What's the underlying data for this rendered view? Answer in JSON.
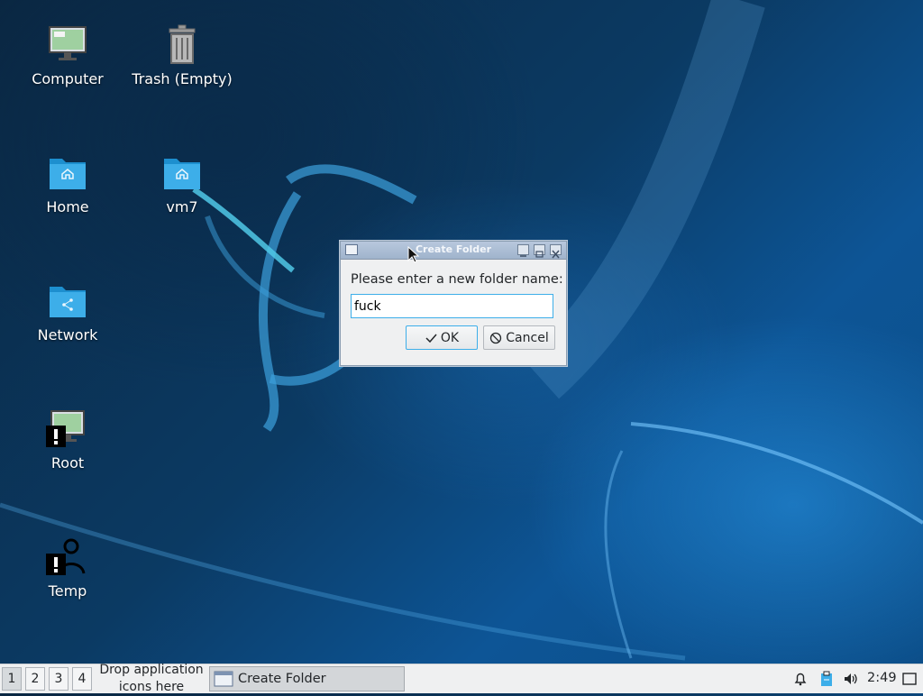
{
  "desktop": {
    "icons": [
      {
        "label": "Computer",
        "icon": "computer-icon"
      },
      {
        "label": "Trash (Empty)",
        "icon": "trash-icon"
      },
      {
        "label": "Home",
        "icon": "home-folder-icon"
      },
      {
        "label": "vm7",
        "icon": "home-folder-icon"
      },
      {
        "label": "Network",
        "icon": "network-folder-icon"
      },
      {
        "label": "Root",
        "icon": "computer-warning-icon"
      },
      {
        "label": "Temp",
        "icon": "user-warning-icon"
      }
    ]
  },
  "dialog": {
    "title": "Create Folder",
    "prompt": "Please enter a new folder name:",
    "input_value": "fuck",
    "ok_label": "OK",
    "cancel_label": "Cancel"
  },
  "taskbar": {
    "workspaces": [
      "1",
      "2",
      "3",
      "4"
    ],
    "active_workspace": "1",
    "drop_text_line1": "Drop application",
    "drop_text_line2": "icons here",
    "task_label": "Create Folder",
    "clock": "2:49"
  },
  "colors": {
    "accent": "#3daee9",
    "folder": "#3daee9",
    "panel": "#eff0f1"
  }
}
